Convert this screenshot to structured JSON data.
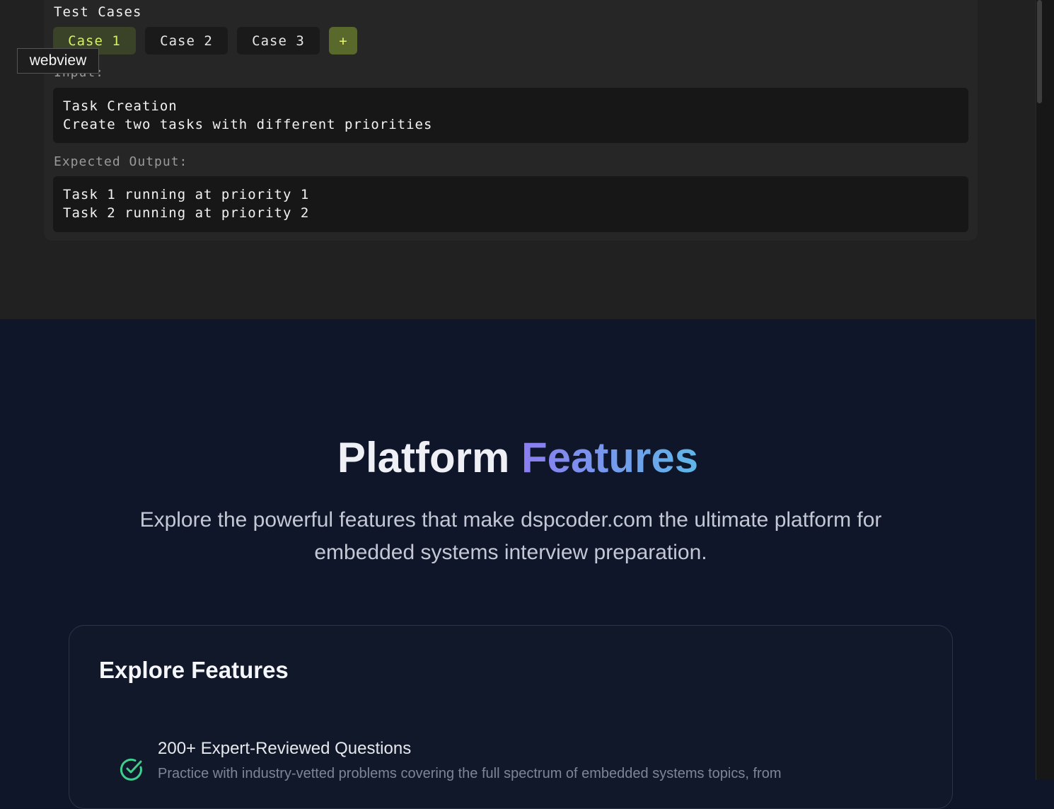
{
  "test_cases": {
    "title": "Test Cases",
    "tabs": [
      {
        "label": "Case 1",
        "active": true
      },
      {
        "label": "Case 2",
        "active": false
      },
      {
        "label": "Case 3",
        "active": false
      }
    ],
    "add_label": "+",
    "input_label": "Input:",
    "input_value": "Task Creation\nCreate two tasks with different priorities",
    "expected_label": "Expected Output:",
    "expected_value": "Task 1 running at priority 1\nTask 2 running at priority 2"
  },
  "tooltip": "webview",
  "features": {
    "title_plain": "Platform",
    "title_accent": "Features",
    "subtitle": "Explore the powerful features that make dspcoder.com the ultimate platform for embedded systems interview preparation.",
    "card_title": "Explore Features",
    "items": [
      {
        "title": "200+ Expert-Reviewed Questions",
        "description": "Practice with industry-vetted problems covering the full spectrum of embedded systems topics, from"
      }
    ]
  },
  "colors": {
    "accent_green": "#d6f062",
    "check_green": "#3ecf8e",
    "gradient_start": "#8b7cf0",
    "gradient_end": "#5fb6e8"
  }
}
